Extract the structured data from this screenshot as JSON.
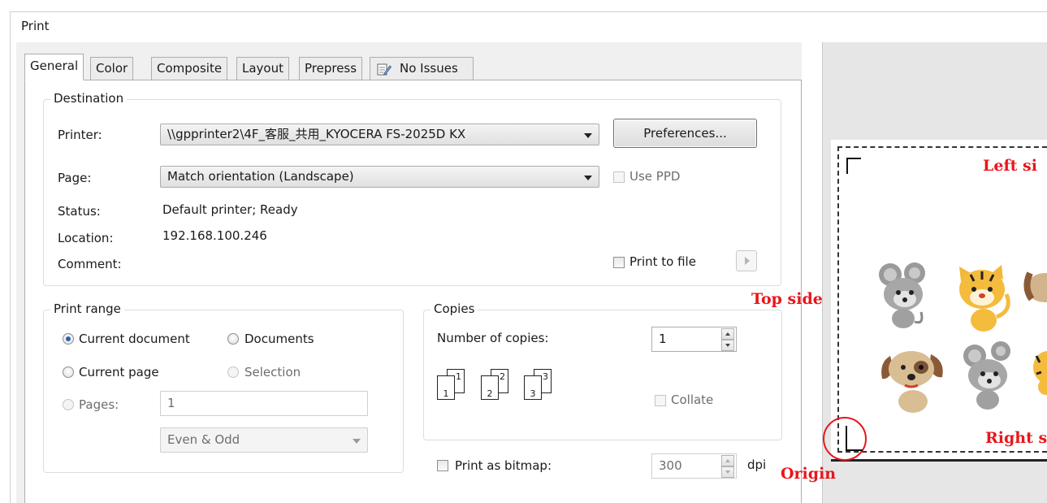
{
  "window": {
    "title": "Print"
  },
  "tabs": [
    {
      "label": "General"
    },
    {
      "label": "Color"
    },
    {
      "label": "Composite"
    },
    {
      "label": "Layout"
    },
    {
      "label": "Prepress"
    },
    {
      "label": "No Issues"
    }
  ],
  "destination": {
    "legend": "Destination",
    "printer_label": "Printer:",
    "printer_value": "\\\\gpprinter2\\4F_客服_共用_KYOCERA FS-2025D KX",
    "preferences_button": "Preferences...",
    "page_label": "Page:",
    "page_value": "Match orientation (Landscape)",
    "use_ppd_label": "Use PPD",
    "status_label": "Status:",
    "status_value": "Default printer; Ready",
    "location_label": "Location:",
    "location_value": "192.168.100.246",
    "comment_label": "Comment:",
    "print_to_file_label": "Print to file"
  },
  "print_range": {
    "legend": "Print range",
    "current_document": "Current document",
    "documents": "Documents",
    "current_page": "Current page",
    "selection": "Selection",
    "pages_label": "Pages:",
    "pages_value": "1",
    "even_odd_value": "Even & Odd"
  },
  "copies": {
    "legend": "Copies",
    "number_label": "Number of copies:",
    "number_value": "1",
    "collate_label": "Collate",
    "collate_icons": [
      {
        "back": "1",
        "front": "1"
      },
      {
        "back": "2",
        "front": "2"
      },
      {
        "back": "3",
        "front": "3"
      }
    ]
  },
  "bitmap": {
    "label": "Print as bitmap:",
    "dpi_value": "300",
    "dpi_unit": "dpi"
  },
  "preview": {
    "annotations": {
      "left_side": "Left si",
      "top_side": "Top side",
      "right_side": "Right s",
      "origin": "Origin"
    },
    "annotation_color": "#e8161c"
  },
  "icons": {
    "no_issues": "checklist-pencil-icon",
    "origin_mark": "origin-corner-icon",
    "corner_mark": "crop-corner-icon",
    "cartoon_animals": [
      "mouse",
      "tiger",
      "dog",
      "dog",
      "mouse",
      "tiger"
    ]
  }
}
